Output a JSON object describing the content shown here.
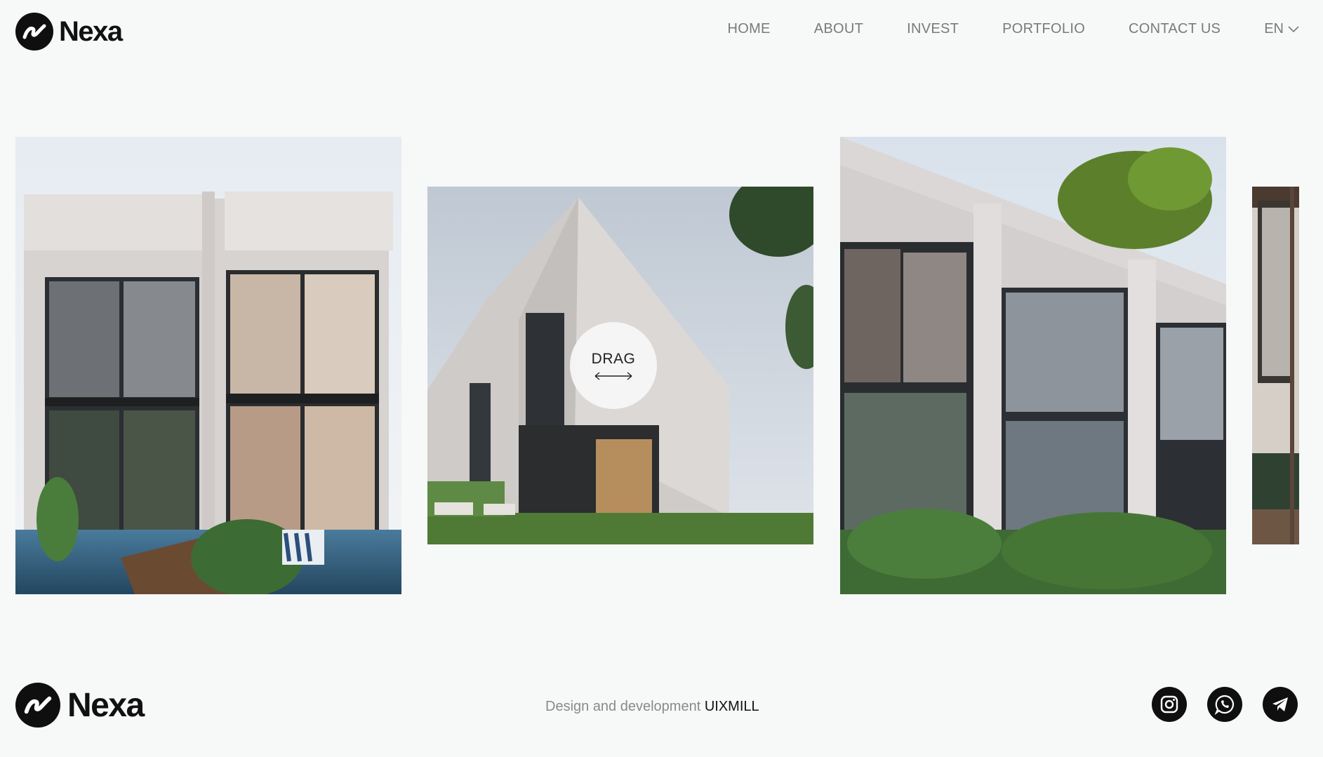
{
  "brand": {
    "name": "Nexa",
    "logo_icon": "nexa-swoosh-icon"
  },
  "nav": {
    "items": [
      "HOME",
      "ABOUT",
      "INVEST",
      "PORTFOLIO",
      "CONTACT US"
    ],
    "language": "EN"
  },
  "slider": {
    "drag_label": "DRAG",
    "slides": [
      {
        "image": "modern-villa-pool-facade"
      },
      {
        "image": "angular-white-house-lawn"
      },
      {
        "image": "white-villa-palms-facade"
      },
      {
        "image": "interior-partial-slide"
      }
    ]
  },
  "footer": {
    "credit_text": "Design and development",
    "credit_link": "UIXMILL",
    "socials": [
      "instagram-icon",
      "whatsapp-icon",
      "telegram-icon"
    ]
  },
  "colors": {
    "background": "#f7f8f8",
    "text": "#111111",
    "nav_text": "#7a7a7a"
  }
}
